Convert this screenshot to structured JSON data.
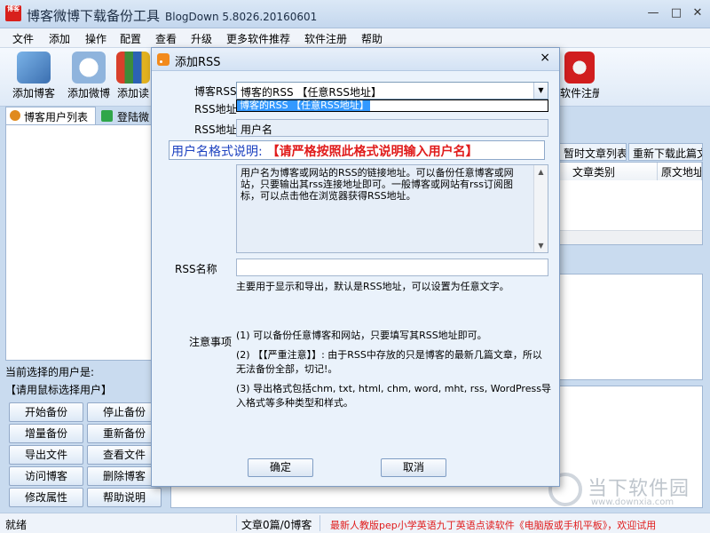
{
  "app": {
    "title": "博客微博下载备份工具",
    "version": "BlogDown 5.8026.20160601",
    "logo_text": "博客"
  },
  "window_controls": {
    "minimize": "—",
    "maximize": "□",
    "close": "✕"
  },
  "menu": [
    "文件",
    "添加",
    "操作",
    "配置",
    "查看",
    "升级",
    "更多软件推荐",
    "软件注册",
    "帮助"
  ],
  "toolbar": {
    "add_blog": "添加博客",
    "add_weibo": "添加微博",
    "add_reader": "添加读",
    "register": "软件注册"
  },
  "left_panel": {
    "tab_users": "博客用户列表",
    "tab_login": "登陆微",
    "current_user_label": "当前选择的用户是:",
    "current_user_value": "【请用鼠标选择用户】",
    "buttons": [
      "开始备份",
      "停止备份",
      "增量备份",
      "重新备份",
      "导出文件",
      "查看文件",
      "访问博客",
      "删除博客",
      "修改属性",
      "帮助说明"
    ]
  },
  "right_panel": {
    "tab_timed": "暂时文章列表",
    "tab_redownload": "重新下载此篇文",
    "columns": [
      "文章类别",
      "原文地址"
    ]
  },
  "status": {
    "ready": "就绪",
    "counts": "文章0篇/0博客",
    "promo": "最新人教版pep小学英语九丁英语点读软件《电脑版或手机平板》，欢迎试用"
  },
  "dialog": {
    "title": "添加RSS",
    "close": "×",
    "label_blog_rss": "博客RSS",
    "label_rss_url": "RSS地址",
    "label_rss_url2": "RSS地址",
    "combo_value": "博客的RSS 【任意RSS地址】",
    "combo_option": "博客的RSS 【任意RSS地址】",
    "username_value": "用户名",
    "format_note_prefix": "用户名格式说明:",
    "format_note_emphasis": "【请严格按照此格式说明输入用户名】",
    "help_text": "用户名为博客或网站的RSS的链接地址。可以备份任意博客或网站，只要输出其rss连接地址即可。一般博客或网站有rss订阅图标，可以点击他在浏览器获得RSS地址。",
    "label_rss_name": "RSS名称",
    "rss_name_value": "",
    "rss_name_desc": "主要用于显示和导出，默认是RSS地址，可以设置为任意文字。",
    "label_notes": "注意事项",
    "note1": "(1) 可以备份任意博客和网站，只要填写其RSS地址即可。",
    "note2": "(2) 【【严重注意】】: 由于RSS中存放的只是博客的最新几篇文章，所以无法备份全部，切记!。",
    "note3": "(3) 导出格式包括chm, txt, html, chm, word, mht, rss, WordPress导入格式等多种类型和样式。",
    "ok": "确定",
    "cancel": "取消"
  },
  "watermark": {
    "cn": "当下软件园",
    "en": "www.downxia.com"
  },
  "colors": {
    "accent_red": "#e01b1b",
    "accent_blue": "#1a3fbf",
    "selection": "#3399ff"
  }
}
